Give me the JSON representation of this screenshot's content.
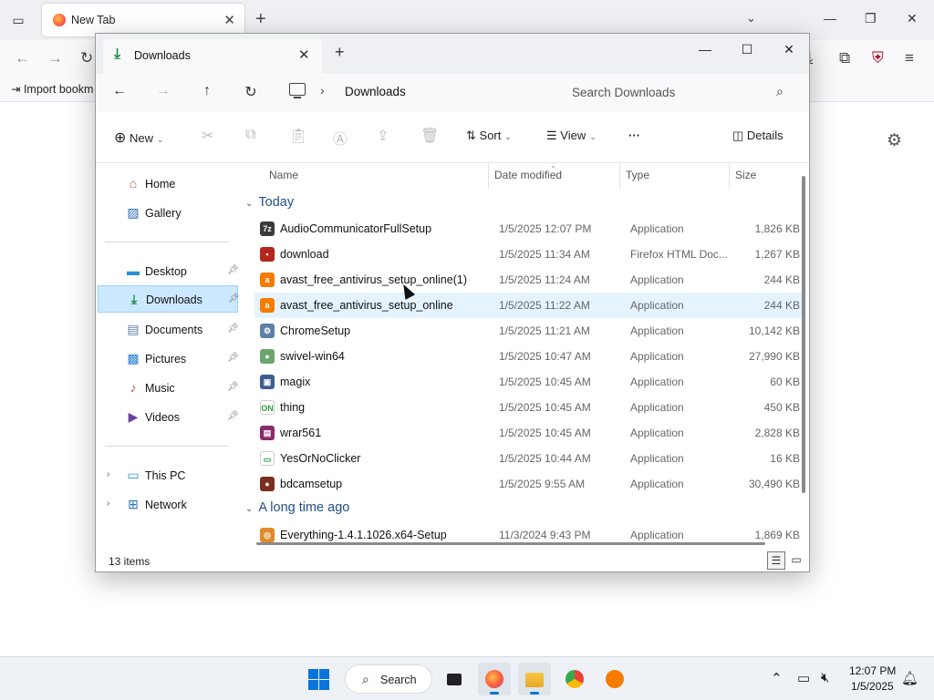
{
  "firefox": {
    "tab_title": "New Tab",
    "bookmark_import": "Import bookm",
    "icons": {
      "tabs": "tab-list-icon",
      "settings": "gear-icon"
    }
  },
  "explorer": {
    "tab_title": "Downloads",
    "breadcrumb": "Downloads",
    "search_placeholder": "Search Downloads",
    "toolbar": {
      "new_label": "New",
      "sort_label": "Sort",
      "view_label": "View",
      "more_label": "···",
      "details_label": "Details"
    },
    "columns": {
      "name": "Name",
      "date": "Date modified",
      "type": "Type",
      "size": "Size"
    },
    "nav": [
      {
        "label": "Home",
        "icon": "home-icon",
        "pinned": false
      },
      {
        "label": "Gallery",
        "icon": "gallery-icon",
        "pinned": false
      },
      {
        "label": "Desktop",
        "icon": "desktop-icon",
        "pinned": true
      },
      {
        "label": "Downloads",
        "icon": "download-icon",
        "pinned": true,
        "selected": true
      },
      {
        "label": "Documents",
        "icon": "documents-icon",
        "pinned": true
      },
      {
        "label": "Pictures",
        "icon": "pictures-icon",
        "pinned": true
      },
      {
        "label": "Music",
        "icon": "music-icon",
        "pinned": true
      },
      {
        "label": "Videos",
        "icon": "videos-icon",
        "pinned": true
      },
      {
        "label": "This PC",
        "icon": "pc-icon",
        "expandable": true
      },
      {
        "label": "Network",
        "icon": "network-icon",
        "expandable": true
      }
    ],
    "groups": [
      {
        "label": "Today"
      },
      {
        "label": "A long time ago"
      }
    ],
    "files": [
      {
        "name": "AudioCommunicatorFullSetup",
        "date": "1/5/2025 12:07 PM",
        "type": "Application",
        "size": "1,826 KB",
        "icon": "installer-icon",
        "color": "#3a3a3a",
        "glyph": "7z"
      },
      {
        "name": "download",
        "date": "1/5/2025 11:34 AM",
        "type": "Firefox HTML Doc...",
        "size": "1,267 KB",
        "icon": "html-doc-icon",
        "color": "#b3261e",
        "glyph": "▪"
      },
      {
        "name": "avast_free_antivirus_setup_online(1)",
        "date": "1/5/2025 11:24 AM",
        "type": "Application",
        "size": "244 KB",
        "icon": "avast-icon",
        "color": "#f57c00",
        "glyph": "a"
      },
      {
        "name": "avast_free_antivirus_setup_online",
        "date": "1/5/2025 11:22 AM",
        "type": "Application",
        "size": "244 KB",
        "icon": "avast-icon",
        "color": "#f57c00",
        "glyph": "a",
        "hover": true
      },
      {
        "name": "ChromeSetup",
        "date": "1/5/2025 11:21 AM",
        "type": "Application",
        "size": "10,142 KB",
        "icon": "setup-icon",
        "color": "#5b7fa6",
        "glyph": "⚙"
      },
      {
        "name": "swivel-win64",
        "date": "1/5/2025 10:47 AM",
        "type": "Application",
        "size": "27,990 KB",
        "icon": "swivel-icon",
        "color": "#6aa56a",
        "glyph": "●"
      },
      {
        "name": "magix",
        "date": "1/5/2025 10:45 AM",
        "type": "Application",
        "size": "60 KB",
        "icon": "window-app-icon",
        "color": "#3b5f8f",
        "glyph": "▣"
      },
      {
        "name": "thing",
        "date": "1/5/2025 10:45 AM",
        "type": "Application",
        "size": "450 KB",
        "icon": "on-icon",
        "color": "#ffffff",
        "glyph": "ON"
      },
      {
        "name": "wrar561",
        "date": "1/5/2025 10:45 AM",
        "type": "Application",
        "size": "2,828 KB",
        "icon": "winrar-icon",
        "color": "#8b2a6b",
        "glyph": "▤"
      },
      {
        "name": "YesOrNoClicker",
        "date": "1/5/2025 10:44 AM",
        "type": "Application",
        "size": "16 KB",
        "icon": "window-app-icon",
        "color": "#ffffff",
        "glyph": "▭"
      },
      {
        "name": "bdcamsetup",
        "date": "1/5/2025 9:55 AM",
        "type": "Application",
        "size": "30,490 KB",
        "icon": "bandicam-icon",
        "color": "#7a2e1e",
        "glyph": "●"
      },
      {
        "name": "Everything-1.4.1.1026.x64-Setup",
        "date": "11/3/2024 9:43 PM",
        "type": "Application",
        "size": "1,869 KB",
        "icon": "everything-icon",
        "color": "#e08a2a",
        "glyph": "◎"
      }
    ],
    "status": "13 items"
  },
  "taskbar": {
    "search_label": "Search",
    "time": "12:07 PM",
    "date": "1/5/2025",
    "apps": [
      "task-view-icon",
      "firefox-icon",
      "file-explorer-icon",
      "chrome-icon",
      "avast-icon"
    ]
  },
  "colors": {
    "accent": "#0a74da",
    "selection": "#cce8ff",
    "group": "#1f4e8c"
  }
}
